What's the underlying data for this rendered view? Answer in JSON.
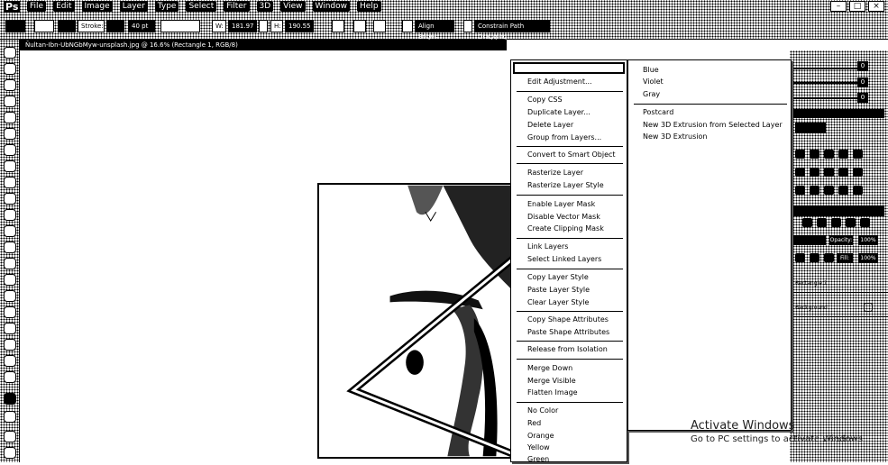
{
  "app": {
    "logo": "Ps"
  },
  "menubar": {
    "items": [
      "File",
      "Edit",
      "Image",
      "Layer",
      "Type",
      "Select",
      "Filter",
      "3D",
      "View",
      "Window",
      "Help"
    ]
  },
  "options": {
    "stroke_label": "Stroke:",
    "stroke_width": "40 pt",
    "w_label": "W:",
    "w_value": "181.97",
    "h_label": "H:",
    "h_value": "190.55",
    "align_edges": "Align Edges",
    "constrain_label": "Constrain Path Dragging"
  },
  "document": {
    "tab_title": "Ñultan-Ibn-UbNGbMyw-unsplash.jpg @ 16.6% (Rectangle 1, RGB/8)"
  },
  "context_menu": {
    "top_item": "",
    "items": [
      "Edit Adjustment...",
      "Copy CSS",
      "Duplicate Layer...",
      "Delete Layer",
      "Group from Layers...",
      "Convert to Smart Object",
      "Rasterize Layer",
      "Rasterize Layer Style",
      "Enable Layer Mask",
      "Disable Vector Mask",
      "Create Clipping Mask",
      "Link Layers",
      "Select Linked Layers",
      "Copy Layer Style",
      "Paste Layer Style",
      "Clear Layer Style",
      "Copy Shape Attributes",
      "Paste Shape Attributes",
      "Release from Isolation",
      "Merge Down",
      "Merge Visible",
      "Flatten Image",
      "No Color",
      "Red",
      "Orange",
      "Yellow",
      "Green"
    ]
  },
  "submenu": {
    "items": [
      "Blue",
      "Violet",
      "Gray",
      "Postcard",
      "New 3D Extrusion from Selected Layer",
      "New 3D Extrusion"
    ]
  },
  "panels": {
    "slider_values": [
      "0",
      "0",
      "0"
    ],
    "opacity_label": "Opacity:",
    "opacity_value": "100%",
    "fill_label": "Fill:",
    "fill_value": "100%",
    "layer1": "Rectangle 1",
    "layer2": "Background"
  },
  "watermark": {
    "line1": "Activate Windows",
    "line2": "Go to PC settings to activate Windows."
  }
}
